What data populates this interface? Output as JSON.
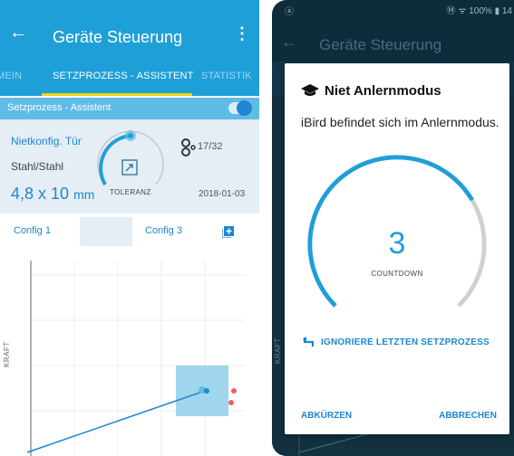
{
  "left": {
    "appbar": {
      "title": "Geräte Steuerung",
      "back_icon": "←",
      "more_icon": "⋮"
    },
    "tabs": {
      "items": [
        "MEIN",
        "SETZPROZESS - ASSISTENT",
        "STATISTIK"
      ],
      "active": "SETZPROZESS - ASSISTENT"
    },
    "assistant": {
      "label": "Setzprozess - Assistent",
      "toggle_on": true
    },
    "card": {
      "name": "Nietkonfig. Tür",
      "material": "Stahl/Stahl",
      "size_value": "4,8 x 10",
      "size_unit": "mm",
      "tolerance_label": "TOLERANZ",
      "count": "17/32",
      "date": "2018-01-03"
    },
    "configs": {
      "items": [
        "Config 1",
        "Config 3"
      ],
      "add_icon": "add-box-icon"
    },
    "chart": {
      "ylabel": "KRAFT"
    }
  },
  "right": {
    "status": {
      "left": "ⓐ",
      "right": "Ⓜ ᯤ 100% ▮ 14"
    },
    "appbar": {
      "title": "Geräte Steuerung",
      "back_icon": "←"
    },
    "dialog": {
      "title": "Niet Anlernmodus",
      "message": "iBird befindet sich im Anlernmodus.",
      "countdown_value": "3",
      "countdown_label": "COUNTDOWN",
      "countdown_progress": 0.72,
      "ignore_label": "IGNORIERE LETZTEN SETZPROZESS",
      "short_label": "ABKÜRZEN",
      "cancel_label": "ABBRECHEN"
    },
    "bg_ylabel": "KRAFT"
  },
  "colors": {
    "primary": "#1f9fd8",
    "accent": "#f3d20f",
    "link": "#1f86d0",
    "point_red": "#f0605a"
  }
}
